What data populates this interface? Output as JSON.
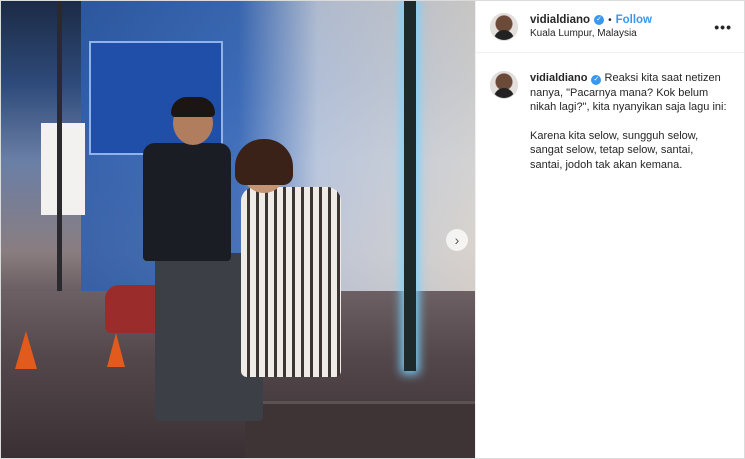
{
  "post": {
    "username": "vidialdiano",
    "follow_label": "Follow",
    "separator": "•",
    "location": "Kuala Lumpur, Malaysia",
    "more_label": "•••",
    "caption_intro": "Reaksi kita saat netizen nanya, \"Pacarnya mana? Kok belum nikah lagi?\", kita nyanyikan saja lagu ini:",
    "caption_lyrics": "Karena kita selow, sungguh selow, sangat selow, tetap selow, santai, santai, jodoh tak akan kemana.",
    "next_label": "›"
  },
  "icons": {
    "verified": "verified-badge-icon",
    "more": "more-options-icon",
    "next": "next-arrow-icon"
  },
  "colors": {
    "accent": "#3897f0",
    "text": "#262626",
    "border": "#dbdbdb"
  }
}
